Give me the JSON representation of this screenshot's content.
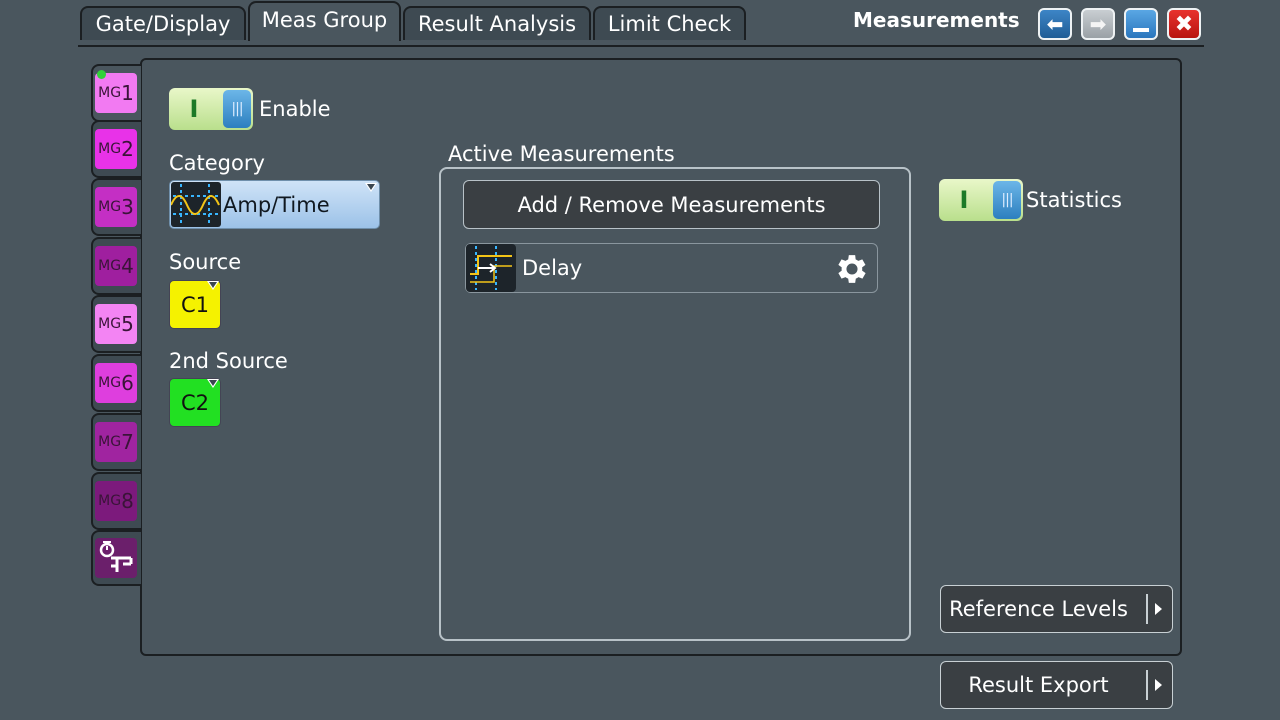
{
  "window": {
    "title": "Measurements"
  },
  "tabs": [
    {
      "label": "Gate/Display"
    },
    {
      "label": "Meas Group"
    },
    {
      "label": "Result Analysis"
    },
    {
      "label": "Limit Check"
    }
  ],
  "meas_groups": [
    {
      "prefix": "MG",
      "num": "1",
      "color": "#f27af2",
      "active": true
    },
    {
      "prefix": "MG",
      "num": "2",
      "color": "#e832e8"
    },
    {
      "prefix": "MG",
      "num": "3",
      "color": "#c42fc4"
    },
    {
      "prefix": "MG",
      "num": "4",
      "color": "#9f1f9f"
    },
    {
      "prefix": "MG",
      "num": "5",
      "color": "#f384f3"
    },
    {
      "prefix": "MG",
      "num": "6",
      "color": "#de3ede"
    },
    {
      "prefix": "MG",
      "num": "7",
      "color": "#a024a0"
    },
    {
      "prefix": "MG",
      "num": "8",
      "color": "#7c1a7c"
    }
  ],
  "enable": {
    "state": "I",
    "label": "Enable"
  },
  "category": {
    "label": "Category",
    "value": "Amp/Time"
  },
  "source": {
    "label": "Source",
    "value": "C1",
    "color": "#f5f200"
  },
  "source2": {
    "label": "2nd Source",
    "value": "C2",
    "color": "#22e022"
  },
  "active_measurements": {
    "label": "Active Measurements",
    "add_remove_label": "Add / Remove Measurements",
    "items": [
      {
        "name": "Delay"
      }
    ]
  },
  "statistics": {
    "state": "I",
    "label": "Statistics"
  },
  "reference_levels": {
    "label": "Reference Levels"
  },
  "result_export": {
    "label": "Result Export"
  }
}
